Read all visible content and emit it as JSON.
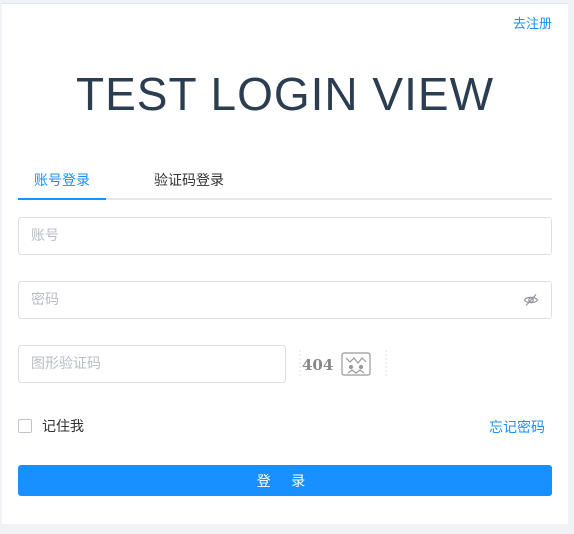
{
  "header": {
    "register_link": "去注册",
    "title": "TEST LOGIN VIEW"
  },
  "tabs": [
    {
      "label": "账号登录",
      "active": true
    },
    {
      "label": "验证码登录",
      "active": false
    }
  ],
  "form": {
    "account_placeholder": "账号",
    "account_value": "",
    "password_placeholder": "密码",
    "password_value": "",
    "password_toggle_icon": "eye-off-icon",
    "captcha_placeholder": "图形验证码",
    "captcha_value": "",
    "captcha_image_text": "404",
    "remember_label": "记住我",
    "remember_checked": false,
    "forgot_link": "忘记密码",
    "login_button": "登 录"
  },
  "colors": {
    "accent": "#1890ff",
    "title": "#2b3d51",
    "border": "#dcdfe6",
    "placeholder": "#b8bcc4"
  }
}
